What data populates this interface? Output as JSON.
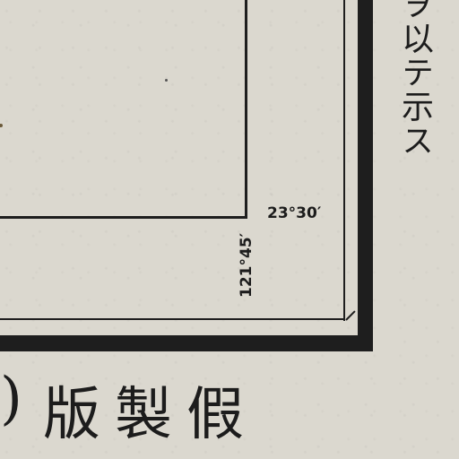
{
  "map": {
    "coordinates": {
      "latitude_label": "23°30′",
      "longitude_label": "121°45′"
    },
    "side_note": "ヲ以テ示ス",
    "edition_paren": ")",
    "edition_label": "版製假"
  },
  "colors": {
    "paper": "#dbd8cf",
    "ink": "#1e1e1e"
  }
}
